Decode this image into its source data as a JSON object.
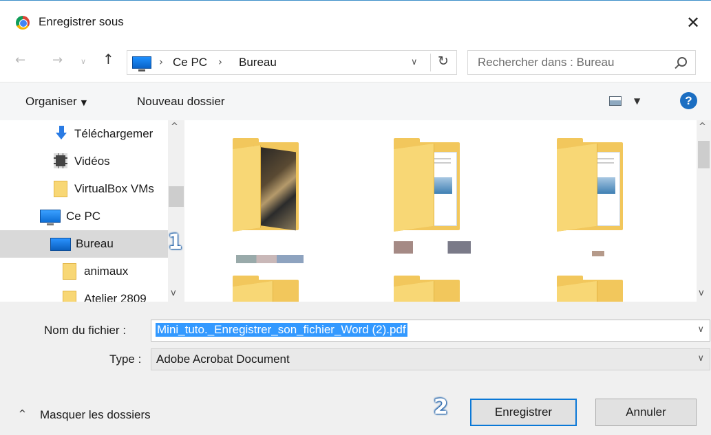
{
  "dialog": {
    "title": "Enregistrer sous",
    "close_glyph": "✕"
  },
  "address": {
    "back_glyph": "←",
    "forward_glyph": "→",
    "history_glyph": "∨",
    "up_glyph": "↑",
    "sep_glyph": "›",
    "crumbs": [
      "Ce PC",
      "Bureau"
    ],
    "dropdown_glyph": "∨",
    "refresh_glyph": "↻"
  },
  "search": {
    "placeholder": "Rechercher dans : Bureau"
  },
  "toolbar": {
    "organize_label": "Organiser",
    "caret_glyph": "▼",
    "new_folder_label": "Nouveau dossier",
    "help_glyph": "?"
  },
  "nav_tree": {
    "items": [
      {
        "label": "Téléchargemer",
        "icon": "download-arrow-icon"
      },
      {
        "label": "Vidéos",
        "icon": "film-icon"
      },
      {
        "label": "VirtualBox VMs",
        "icon": "folder-icon"
      },
      {
        "label": "Ce PC",
        "icon": "computer-icon"
      },
      {
        "label": "Bureau",
        "icon": "desktop-icon",
        "selected": true
      },
      {
        "label": "animaux",
        "icon": "folder-icon"
      },
      {
        "label": "Atelier 2809",
        "icon": "folder-icon"
      }
    ],
    "scroll_up_glyph": "^",
    "scroll_down_glyph": "v"
  },
  "annotations": {
    "marker_1": "1",
    "marker_2": "2"
  },
  "form": {
    "filename_label": "Nom du fichier :",
    "filename_value": "Mini_tuto._Enregistrer_son_fichier_Word (2).pdf",
    "type_label": "Type :",
    "type_value": "Adobe Acrobat Document",
    "dropdown_glyph": "∨"
  },
  "footer": {
    "toggle_glyph": "^",
    "hide_folders_label": "Masquer les dossiers",
    "save_label": "Enregistrer",
    "cancel_label": "Annuler"
  },
  "colors": {
    "accent": "#0a78d7",
    "selection": "#3399ff",
    "folder": "#f8d775"
  }
}
